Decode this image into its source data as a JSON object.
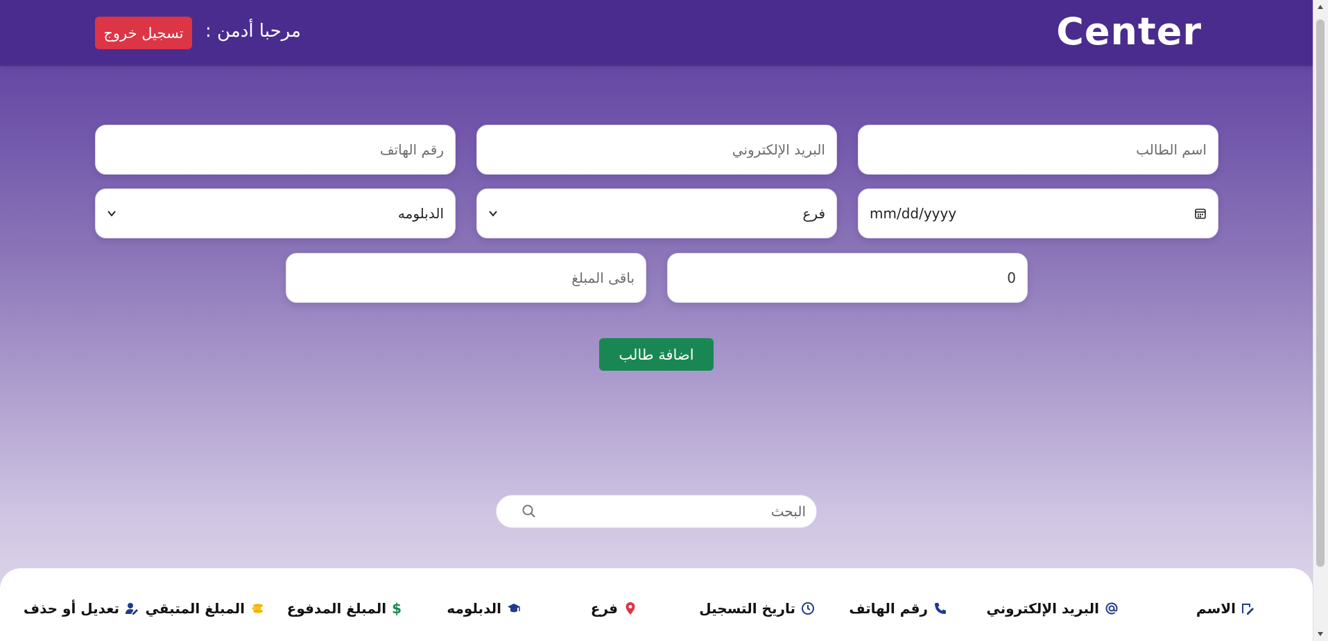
{
  "header": {
    "brand": "Center",
    "welcome": "مرحبا أدمن :",
    "logout_label": "تسجيل خروج"
  },
  "form": {
    "student_name_placeholder": "اسم الطالب",
    "email_placeholder": "البريد الإلكتروني",
    "phone_placeholder": "رقم الهاتف",
    "date_value": "mm/dd/yyyy",
    "branch_selected": "فرع",
    "diploma_selected": "الدبلومه",
    "paid_value": "0",
    "remaining_placeholder": "باقى المبلغ",
    "add_button_label": "اضافة طالب"
  },
  "search": {
    "placeholder": "البحث"
  },
  "table": {
    "headers": [
      {
        "label": "الاسم",
        "icon": "user-edit-icon"
      },
      {
        "label": "البريد الإلكتروني",
        "icon": "at-icon"
      },
      {
        "label": "رقم الهاتف",
        "icon": "phone-icon"
      },
      {
        "label": "تاريخ التسجيل",
        "icon": "clock-icon"
      },
      {
        "label": "فرع",
        "icon": "location-pin-icon"
      },
      {
        "label": "الدبلومه",
        "icon": "graduation-cap-icon"
      },
      {
        "label": "المبلغ المدفوع",
        "icon": "dollar-icon"
      },
      {
        "label": "المبلغ المتبقي",
        "icon": "coins-icon"
      },
      {
        "label": "تعديل أو حذف",
        "icon": "user-gear-icon"
      }
    ]
  },
  "colors": {
    "navbar": "#4a2c8e",
    "logout": "#dc3545",
    "add": "#198754",
    "icon_blue": "#1e3a8a",
    "pin_red": "#dc3545",
    "dollar_green": "#198754",
    "coins_gold": "#f4b400"
  }
}
